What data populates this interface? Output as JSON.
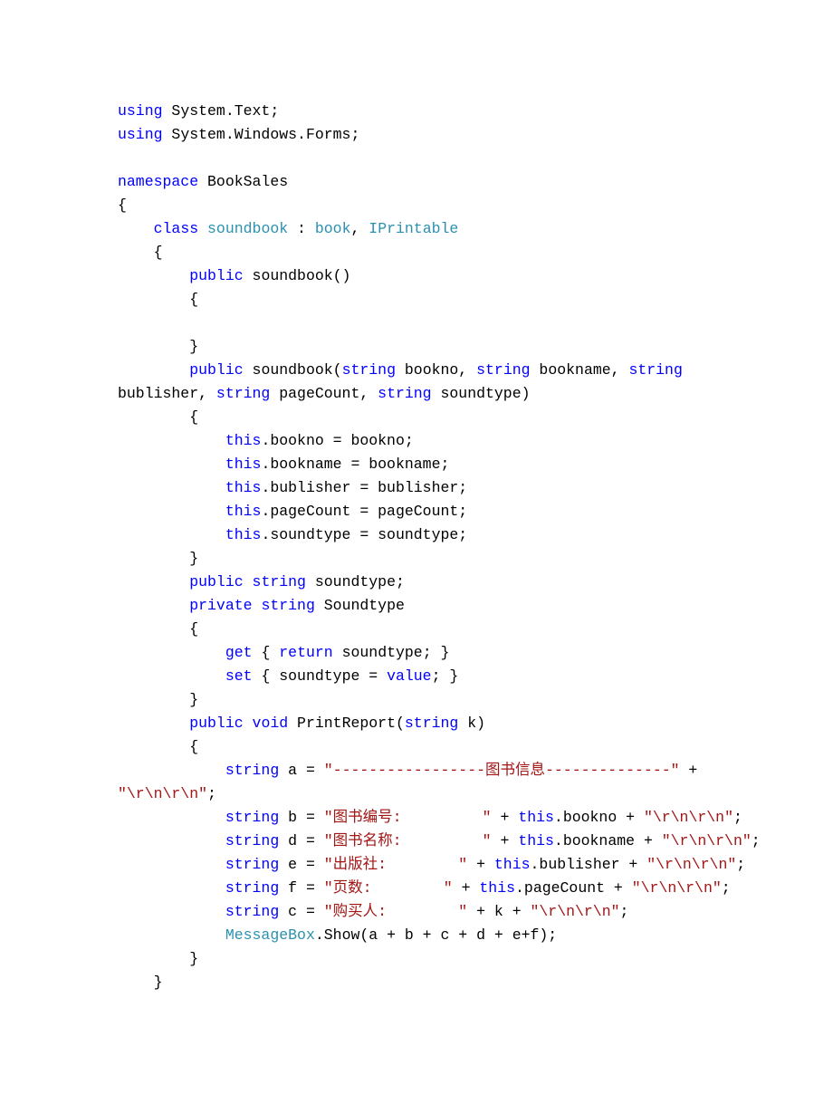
{
  "code": {
    "lines": [
      [
        {
          "t": "using",
          "c": "kw"
        },
        {
          "t": " System.Text;"
        }
      ],
      [
        {
          "t": "using",
          "c": "kw"
        },
        {
          "t": " System.Windows.Forms;"
        }
      ],
      [],
      [
        {
          "t": "namespace",
          "c": "kw"
        },
        {
          "t": " BookSales"
        }
      ],
      [
        {
          "t": "{"
        }
      ],
      [
        {
          "t": "    "
        },
        {
          "t": "class",
          "c": "kw"
        },
        {
          "t": " "
        },
        {
          "t": "soundbook",
          "c": "type"
        },
        {
          "t": " : "
        },
        {
          "t": "book",
          "c": "type"
        },
        {
          "t": ", "
        },
        {
          "t": "IPrintable",
          "c": "type"
        }
      ],
      [
        {
          "t": "    {"
        }
      ],
      [
        {
          "t": "        "
        },
        {
          "t": "public",
          "c": "kw"
        },
        {
          "t": " soundbook()"
        }
      ],
      [
        {
          "t": "        {"
        }
      ],
      [],
      [
        {
          "t": "        }"
        }
      ],
      [
        {
          "t": "        "
        },
        {
          "t": "public",
          "c": "kw"
        },
        {
          "t": " soundbook("
        },
        {
          "t": "string",
          "c": "kw"
        },
        {
          "t": " bookno, "
        },
        {
          "t": "string",
          "c": "kw"
        },
        {
          "t": " bookname, "
        },
        {
          "t": "string",
          "c": "kw"
        },
        {
          "t": " "
        }
      ],
      [
        {
          "t": "bublisher, "
        },
        {
          "t": "string",
          "c": "kw"
        },
        {
          "t": " pageCount, "
        },
        {
          "t": "string",
          "c": "kw"
        },
        {
          "t": " soundtype)"
        }
      ],
      [
        {
          "t": "        {"
        }
      ],
      [
        {
          "t": "            "
        },
        {
          "t": "this",
          "c": "kw"
        },
        {
          "t": ".bookno = bookno;"
        }
      ],
      [
        {
          "t": "            "
        },
        {
          "t": "this",
          "c": "kw"
        },
        {
          "t": ".bookname = bookname;"
        }
      ],
      [
        {
          "t": "            "
        },
        {
          "t": "this",
          "c": "kw"
        },
        {
          "t": ".bublisher = bublisher;"
        }
      ],
      [
        {
          "t": "            "
        },
        {
          "t": "this",
          "c": "kw"
        },
        {
          "t": ".pageCount = pageCount;"
        }
      ],
      [
        {
          "t": "            "
        },
        {
          "t": "this",
          "c": "kw"
        },
        {
          "t": ".soundtype = soundtype;"
        }
      ],
      [
        {
          "t": "        }"
        }
      ],
      [
        {
          "t": "        "
        },
        {
          "t": "public",
          "c": "kw"
        },
        {
          "t": " "
        },
        {
          "t": "string",
          "c": "kw"
        },
        {
          "t": " soundtype;"
        }
      ],
      [
        {
          "t": "        "
        },
        {
          "t": "private",
          "c": "kw"
        },
        {
          "t": " "
        },
        {
          "t": "string",
          "c": "kw"
        },
        {
          "t": " Soundtype"
        }
      ],
      [
        {
          "t": "        {"
        }
      ],
      [
        {
          "t": "            "
        },
        {
          "t": "get",
          "c": "kw"
        },
        {
          "t": " { "
        },
        {
          "t": "return",
          "c": "kw"
        },
        {
          "t": " soundtype; }"
        }
      ],
      [
        {
          "t": "            "
        },
        {
          "t": "set",
          "c": "kw"
        },
        {
          "t": " { soundtype = "
        },
        {
          "t": "value",
          "c": "kw"
        },
        {
          "t": "; }"
        }
      ],
      [
        {
          "t": "        }"
        }
      ],
      [
        {
          "t": "        "
        },
        {
          "t": "public",
          "c": "kw"
        },
        {
          "t": " "
        },
        {
          "t": "void",
          "c": "kw"
        },
        {
          "t": " PrintReport("
        },
        {
          "t": "string",
          "c": "kw"
        },
        {
          "t": " k)"
        }
      ],
      [
        {
          "t": "        {"
        }
      ],
      [
        {
          "t": "            "
        },
        {
          "t": "string",
          "c": "kw"
        },
        {
          "t": " a = "
        },
        {
          "t": "\"-----------------图书信息--------------\"",
          "c": "str"
        },
        {
          "t": " + "
        }
      ],
      [
        {
          "t": "\"\\r\\n\\r\\n\"",
          "c": "str"
        },
        {
          "t": ";"
        }
      ],
      [
        {
          "t": "            "
        },
        {
          "t": "string",
          "c": "kw"
        },
        {
          "t": " b = "
        },
        {
          "t": "\"图书编号:         \"",
          "c": "str"
        },
        {
          "t": " + "
        },
        {
          "t": "this",
          "c": "kw"
        },
        {
          "t": ".bookno + "
        },
        {
          "t": "\"\\r\\n\\r\\n\"",
          "c": "str"
        },
        {
          "t": ";"
        }
      ],
      [
        {
          "t": "            "
        },
        {
          "t": "string",
          "c": "kw"
        },
        {
          "t": " d = "
        },
        {
          "t": "\"图书名称:         \"",
          "c": "str"
        },
        {
          "t": " + "
        },
        {
          "t": "this",
          "c": "kw"
        },
        {
          "t": ".bookname + "
        },
        {
          "t": "\"\\r\\n\\r\\n\"",
          "c": "str"
        },
        {
          "t": ";"
        }
      ],
      [
        {
          "t": "            "
        },
        {
          "t": "string",
          "c": "kw"
        },
        {
          "t": " e = "
        },
        {
          "t": "\"出版社:        \"",
          "c": "str"
        },
        {
          "t": " + "
        },
        {
          "t": "this",
          "c": "kw"
        },
        {
          "t": ".bublisher + "
        },
        {
          "t": "\"\\r\\n\\r\\n\"",
          "c": "str"
        },
        {
          "t": ";"
        }
      ],
      [
        {
          "t": "            "
        },
        {
          "t": "string",
          "c": "kw"
        },
        {
          "t": " f = "
        },
        {
          "t": "\"页数:        \"",
          "c": "str"
        },
        {
          "t": " + "
        },
        {
          "t": "this",
          "c": "kw"
        },
        {
          "t": ".pageCount + "
        },
        {
          "t": "\"\\r\\n\\r\\n\"",
          "c": "str"
        },
        {
          "t": ";"
        }
      ],
      [
        {
          "t": "            "
        },
        {
          "t": "string",
          "c": "kw"
        },
        {
          "t": " c = "
        },
        {
          "t": "\"购买人:        \"",
          "c": "str"
        },
        {
          "t": " + k + "
        },
        {
          "t": "\"\\r\\n\\r\\n\"",
          "c": "str"
        },
        {
          "t": ";"
        }
      ],
      [
        {
          "t": "            "
        },
        {
          "t": "MessageBox",
          "c": "type"
        },
        {
          "t": ".Show(a + b + c + d + e+f);"
        }
      ],
      [
        {
          "t": "        }"
        }
      ],
      [
        {
          "t": "    }"
        }
      ]
    ]
  }
}
